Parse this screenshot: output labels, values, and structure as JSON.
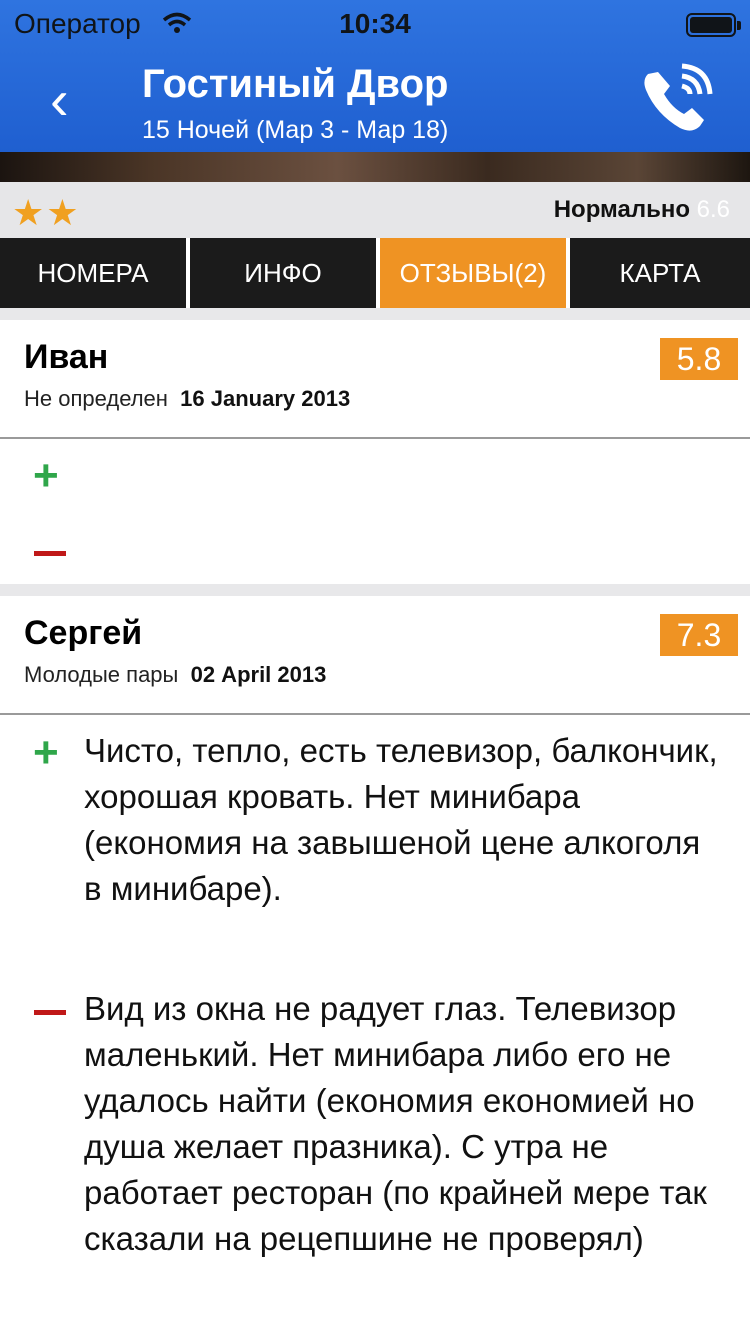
{
  "status": {
    "carrier": "Оператор",
    "time": "10:34"
  },
  "header": {
    "title": "Гостиный Двор",
    "subtitle": "15 Ночей (Мар 3 - Мар 18)",
    "back_icon": "chevron-left-icon",
    "call_icon": "phone-icon"
  },
  "rating": {
    "stars": "★★",
    "label": "Нормально",
    "score": "6.6"
  },
  "tabs": [
    "НОМЕРА",
    "ИНФО",
    "ОТЗЫВЫ(2)",
    "КАРТА"
  ],
  "reviews": [
    {
      "name": "Иван",
      "type": "Не определен",
      "date": "16 January 2013",
      "score": "5.8",
      "pros": "",
      "cons": ""
    },
    {
      "name": "Сергей",
      "type": "Молодые пары",
      "date": "02 April 2013",
      "score": "7.3",
      "pros": "Чисто, тепло, есть телевизор, балкончик, хорошая кровать. Нет минибара (економия на завышеной цене алкоголя в минибаре).",
      "cons": "Вид из окна не радует глаз. Телевизор маленький. Нет минибара либо его не удалось найти (економия економией но душа желает празника). С утра не работает ресторан (по крайней мере так сказали на рецепшине не проверял)"
    }
  ],
  "colors": {
    "header": "#2f74e0",
    "accent": "#ef9323",
    "plus": "#2fa64a",
    "minus": "#c01818"
  }
}
